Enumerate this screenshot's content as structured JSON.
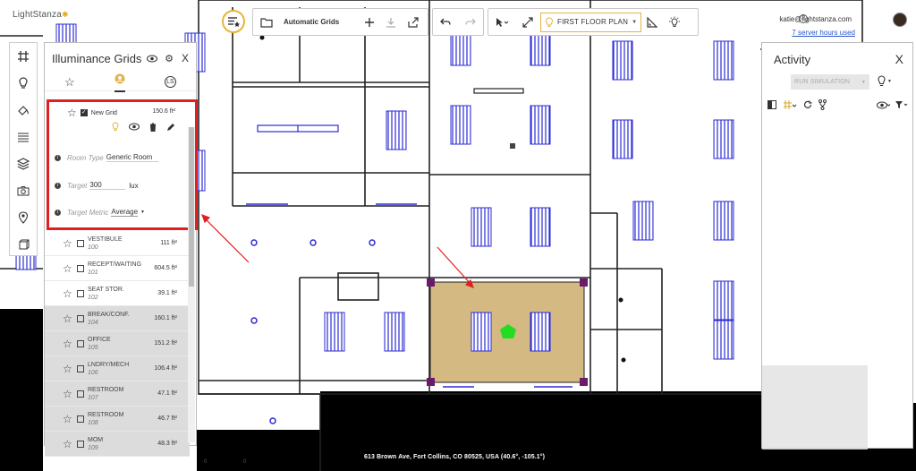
{
  "app": {
    "logo": "LightStanza"
  },
  "toolbar": {
    "grid_label": "Automatic Grids",
    "floor_plan": "FIRST FLOOR PLAN"
  },
  "user": {
    "email": "katie@lightstanza.com",
    "server_hours": "7 server hours used"
  },
  "illuminance": {
    "title": "Illuminance Grids",
    "close": "X",
    "new_grid": {
      "name": "New Grid",
      "area": "150.6 ft²"
    },
    "room_type": {
      "label": "Room Type",
      "value": "Generic Room"
    },
    "target": {
      "label": "Target",
      "value": "300",
      "unit": "lux"
    },
    "target_metric": {
      "label": "Target Metric",
      "value": "Average"
    },
    "rooms": [
      {
        "name": "VESTIBULE",
        "number": "100",
        "area": "111 ft²"
      },
      {
        "name": "RECEPT/WAITING",
        "number": "101",
        "area": "604.5 ft²"
      },
      {
        "name": "SEAT STOR.",
        "number": "102",
        "area": "39.1 ft²"
      },
      {
        "name": "BREAK/CONF.",
        "number": "104",
        "area": "160.1 ft²"
      },
      {
        "name": "OFFICE",
        "number": "105",
        "area": "151.2 ft²"
      },
      {
        "name": "LNDRY/MECH",
        "number": "106",
        "area": "106.4 ft²"
      },
      {
        "name": "RESTROOM",
        "number": "107",
        "area": "47.1 ft²"
      },
      {
        "name": "RESTROOM",
        "number": "108",
        "area": "46.7 ft²"
      },
      {
        "name": "MOM",
        "number": "109",
        "area": "48.3 ft²"
      }
    ]
  },
  "activity": {
    "title": "Activity",
    "close": "X",
    "run_simulation": "RUN SIMULATION"
  },
  "map": {
    "address": "613 Brown Ave, Fort Collins, CO 80525, USA (40.6°, -105.1°)"
  },
  "colors": {
    "accent": "#e8b33a",
    "highlight": "#e02020",
    "room_fill": "#d4b983",
    "fixture": "#2b2bd6",
    "corner": "#6b1a6b",
    "sensor": "#22dd22"
  }
}
